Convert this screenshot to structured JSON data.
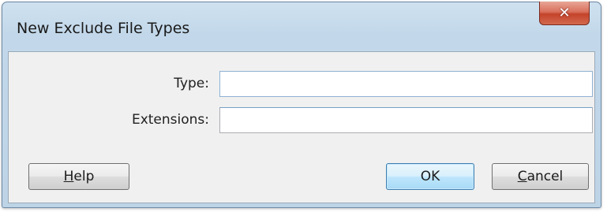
{
  "window": {
    "title": "New Exclude File Types",
    "close_glyph": "✕"
  },
  "form": {
    "type_label": "Type:",
    "type_value": "",
    "extensions_label": "Extensions:",
    "extensions_value": ""
  },
  "buttons": {
    "help": {
      "mnemonic": "H",
      "rest": "elp"
    },
    "ok": {
      "label": "OK"
    },
    "cancel": {
      "mnemonic": "C",
      "rest": "ancel"
    }
  },
  "colors": {
    "titlebar": "#c2d8ea",
    "close_button": "#c4432b",
    "client_background": "#f0f0f0",
    "default_button_border": "#3c7fb1"
  }
}
